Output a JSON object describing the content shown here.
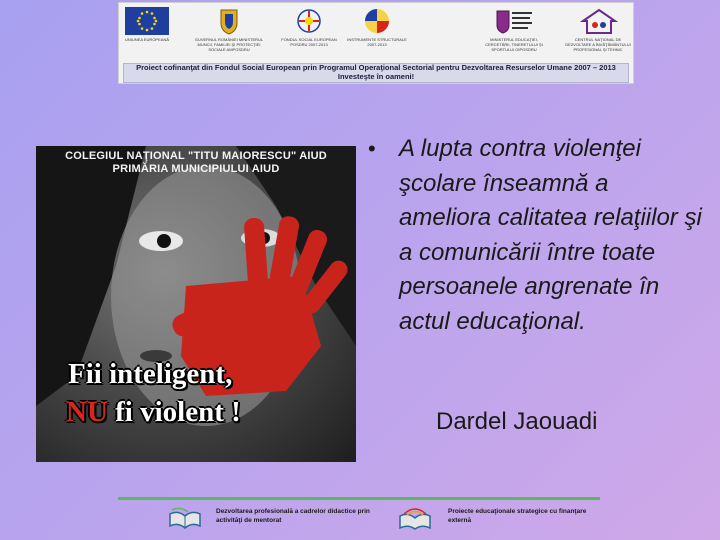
{
  "banner": {
    "logos": [
      {
        "caption": "UNIUNEA EUROPEANĂ"
      },
      {
        "caption": "GUVERNUL ROMÂNIEI MINISTERUL MUNCII, FAMILIEI ŞI PROTECŢIEI SOCIALE AMPOSDRU"
      },
      {
        "caption": "FONDUL SOCIAL EUROPEAN POSDRU 2007-2013"
      },
      {
        "caption": "INSTRUMENTE STRUCTURALE 2007-2013"
      },
      {
        "caption": "MINISTERUL EDUCAŢIEI, CERCETĂRII, TINERETULUI ŞI SPORTULUI OIPOSDRU"
      },
      {
        "caption": "CENTRUL NAŢIONAL DE DEZVOLTARE A ÎNVĂŢĂMÂNTULUI PROFESIONAL ŞI TEHNIC"
      }
    ],
    "strip_line1": "Proiect cofinanţat din Fondul Social European prin Programul Operaţional Sectorial pentru Dezvoltarea Resurselor Umane 2007 – 2013",
    "strip_line2": "Investeşte în oameni!"
  },
  "poster": {
    "header_line1": "COLEGIUL NAŢIONAL \"TITU MAIORESCU\" AIUD",
    "header_line2": "PRIMĂRIA MUNICIPIULUI AIUD",
    "slogan_line1": "Fii inteligent,",
    "slogan_red": "NU",
    "slogan_rest": " fi violent !"
  },
  "content": {
    "bullet": "A lupta contra violenţei şcolare înseamnă a ameliora calitatea relaţiilor şi a comunicării între toate persoanele angrenate în actul educaţional.",
    "author": "Dardel Jaouadi"
  },
  "footer": {
    "left": "Dezvoltarea profesională a cadrelor didactice prin activităţi de mentorat",
    "right": "Proiecte educaţionale strategice cu finanţare externă"
  },
  "colors": {
    "accent_red": "#d8261a",
    "footer_line": "#5cb85c"
  }
}
